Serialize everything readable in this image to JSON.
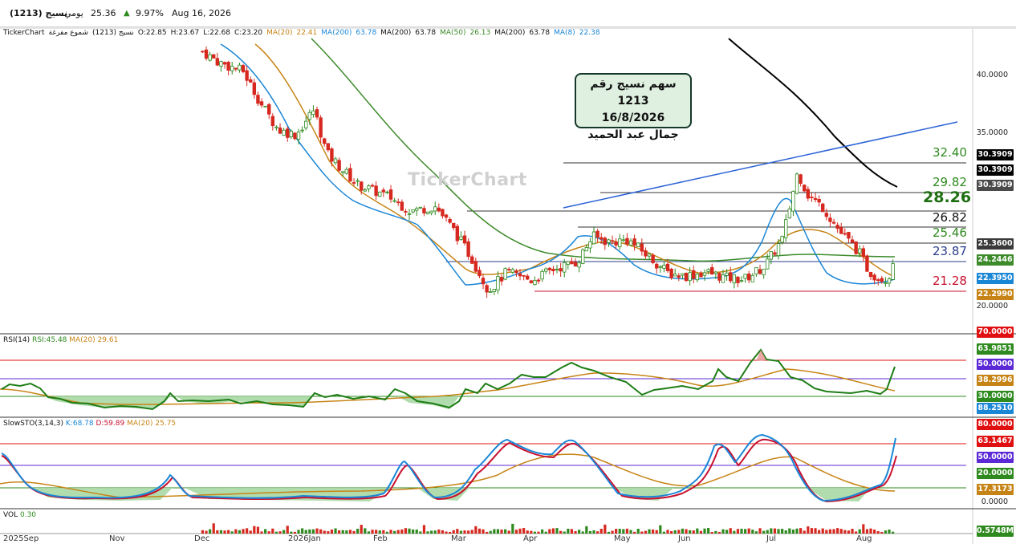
{
  "header": {
    "symbol": "نسيج (1213)",
    "timeframe": "يومي",
    "up_arrow": "▲",
    "last_price": "25.36",
    "change_pct": "9.97%",
    "date": "Aug 16, 2026"
  },
  "legend": {
    "provider": "TickerChart",
    "instrument": "نسيج (1213)",
    "style": "شموع مفرغة",
    "open": "O:22.85",
    "high": "H:23.67",
    "low": "L:22.68",
    "close": "C:23.20",
    "ma1_name": "MA(20)",
    "ma1_val": "22.41",
    "ma2_name": "MA(200)",
    "ma2_val": "63.78",
    "ma3_name": "MA(200)",
    "ma3_val": "63.78",
    "ma4_name": "MA(50)",
    "ma4_val": "26.13",
    "ma5_name": "MA(200)",
    "ma5_val": "63.78",
    "ma6_name": "MA(8)",
    "ma6_val": "22.38"
  },
  "annotation": {
    "line1": "سهم نسيج رقم 1213",
    "line2": "16/8/2026",
    "line3": "جمال عبد الحميد"
  },
  "watermark": "TickerChart",
  "levels": {
    "l1": "32.40",
    "l2": "29.82",
    "l3": "28.26",
    "l4": "26.82",
    "l5": "25.46",
    "l6": "23.87",
    "l7": "21.28"
  },
  "price_axis": {
    "ticks": [
      "40.0000",
      "35.0000",
      "20.0000"
    ],
    "badges": [
      {
        "text": "30.3909",
        "color": "#000000"
      },
      {
        "text": "30.3909",
        "color": "#000000"
      },
      {
        "text": "30.3909",
        "color": "#4a4a4a"
      },
      {
        "text": "25.3600",
        "color": "#3a3a3a"
      },
      {
        "text": "24.2446",
        "color": "#3c8a2a"
      },
      {
        "text": "22.3950",
        "color": "#1a86d6"
      },
      {
        "text": "22.2990",
        "color": "#c78416"
      }
    ]
  },
  "rsi": {
    "label": "RSI(14)",
    "value": "RSI:45.48",
    "ma_name": "MA(20)",
    "ma_val": "29.61",
    "badges": [
      {
        "text": "70.0000",
        "color": "#e01010"
      },
      {
        "text": "63.9851",
        "color": "#2e8a1e"
      },
      {
        "text": "50.0000",
        "color": "#5b2ad6"
      },
      {
        "text": "38.2996",
        "color": "#c78416"
      },
      {
        "text": "30.0000",
        "color": "#2e8a1e"
      },
      {
        "text": "88.2510",
        "color": "#1a86d6"
      }
    ]
  },
  "sto": {
    "label": "SlowSTO(3,14,3)",
    "k": "K:68.78",
    "d": "D:59.89",
    "ma_name": "MA(20)",
    "ma_val": "25.75",
    "badges": [
      {
        "text": "80.0000",
        "color": "#e01010"
      },
      {
        "text": "63.1467",
        "color": "#e01010"
      },
      {
        "text": "50.0000",
        "color": "#5b2ad6"
      },
      {
        "text": "20.0000",
        "color": "#2e8a1e"
      },
      {
        "text": "17.3173",
        "color": "#c78416"
      }
    ],
    "tick": "0.0000"
  },
  "vol": {
    "label": "VOL",
    "value": "0.30",
    "badge": "0.5748M",
    "badge_color": "#2e8a1e"
  },
  "x_axis": [
    "2025Sep",
    "Nov",
    "Dec",
    "2026Jan",
    "Feb",
    "Mar",
    "Apr",
    "May",
    "Jun",
    "Jul",
    "Aug"
  ],
  "colors": {
    "up": "#2e8a1e",
    "down": "#d6281f",
    "ma8": "#1a86d6",
    "ma20": "#c78416",
    "ma50": "#3c8a2a",
    "ma200": "#000000",
    "trend": "#2a62d6"
  },
  "chart_data": {
    "type": "candlestick",
    "title": "سهم نسيج رقم 1213",
    "price_ylim": [
      19.5,
      42
    ],
    "x_range": [
      "2025-08-27",
      "2026-08-16"
    ],
    "ohlc_last": {
      "open": 22.85,
      "high": 23.67,
      "low": 22.68,
      "close": 23.2
    },
    "close_path": [
      [
        "2025-11-15",
        42.0
      ],
      [
        "2025-11-22",
        41.0
      ],
      [
        "2025-12-01",
        40.3
      ],
      [
        "2025-12-08",
        37.5
      ],
      [
        "2025-12-15",
        35.2
      ],
      [
        "2025-12-22",
        34.8
      ],
      [
        "2025-12-29",
        37.0
      ],
      [
        "2026-01-03",
        33.2
      ],
      [
        "2026-01-15",
        30.5
      ],
      [
        "2026-01-28",
        29.4
      ],
      [
        "2026-02-05",
        28.2
      ],
      [
        "2026-02-15",
        28.6
      ],
      [
        "2026-02-22",
        26.6
      ],
      [
        "2026-03-01",
        24.2
      ],
      [
        "2026-03-08",
        21.3
      ],
      [
        "2026-03-15",
        22.9
      ],
      [
        "2026-03-25",
        22.2
      ],
      [
        "2026-04-03",
        23.2
      ],
      [
        "2026-04-12",
        23.8
      ],
      [
        "2026-04-18",
        26.0
      ],
      [
        "2026-04-25",
        25.5
      ],
      [
        "2026-05-02",
        25.7
      ],
      [
        "2026-05-10",
        24.3
      ],
      [
        "2026-05-18",
        22.8
      ],
      [
        "2026-05-25",
        22.6
      ],
      [
        "2026-06-02",
        22.9
      ],
      [
        "2026-06-10",
        22.4
      ],
      [
        "2026-06-17",
        22.3
      ],
      [
        "2026-06-25",
        23.4
      ],
      [
        "2026-07-02",
        25.8
      ],
      [
        "2026-07-08",
        31.6
      ],
      [
        "2026-07-12",
        29.6
      ],
      [
        "2026-07-18",
        28.5
      ],
      [
        "2026-07-25",
        26.3
      ],
      [
        "2026-08-01",
        24.7
      ],
      [
        "2026-08-05",
        23.0
      ],
      [
        "2026-08-09",
        22.4
      ],
      [
        "2026-08-13",
        22.4
      ],
      [
        "2026-08-16",
        25.36
      ]
    ],
    "horizontal_levels": [
      32.4,
      29.82,
      28.26,
      26.82,
      25.46,
      23.87,
      21.28
    ],
    "overlays": [
      {
        "name": "MA(8)",
        "last": 22.38
      },
      {
        "name": "MA(20)",
        "last": 22.41
      },
      {
        "name": "MA(50)",
        "last": 26.13
      },
      {
        "name": "MA(200)",
        "last": 63.78
      }
    ],
    "rsi": {
      "period": 14,
      "last": 45.48,
      "ma20": 29.61,
      "levels": [
        70,
        50,
        30
      ],
      "ylim": [
        0,
        100
      ]
    },
    "stochastic": {
      "params": "3,14,3",
      "k": 68.78,
      "d": 59.89,
      "ma20": 25.75,
      "levels": [
        80,
        50,
        20
      ],
      "ylim": [
        0,
        100
      ]
    },
    "volume": {
      "last": "0.30",
      "scale": "0.5748M"
    }
  }
}
